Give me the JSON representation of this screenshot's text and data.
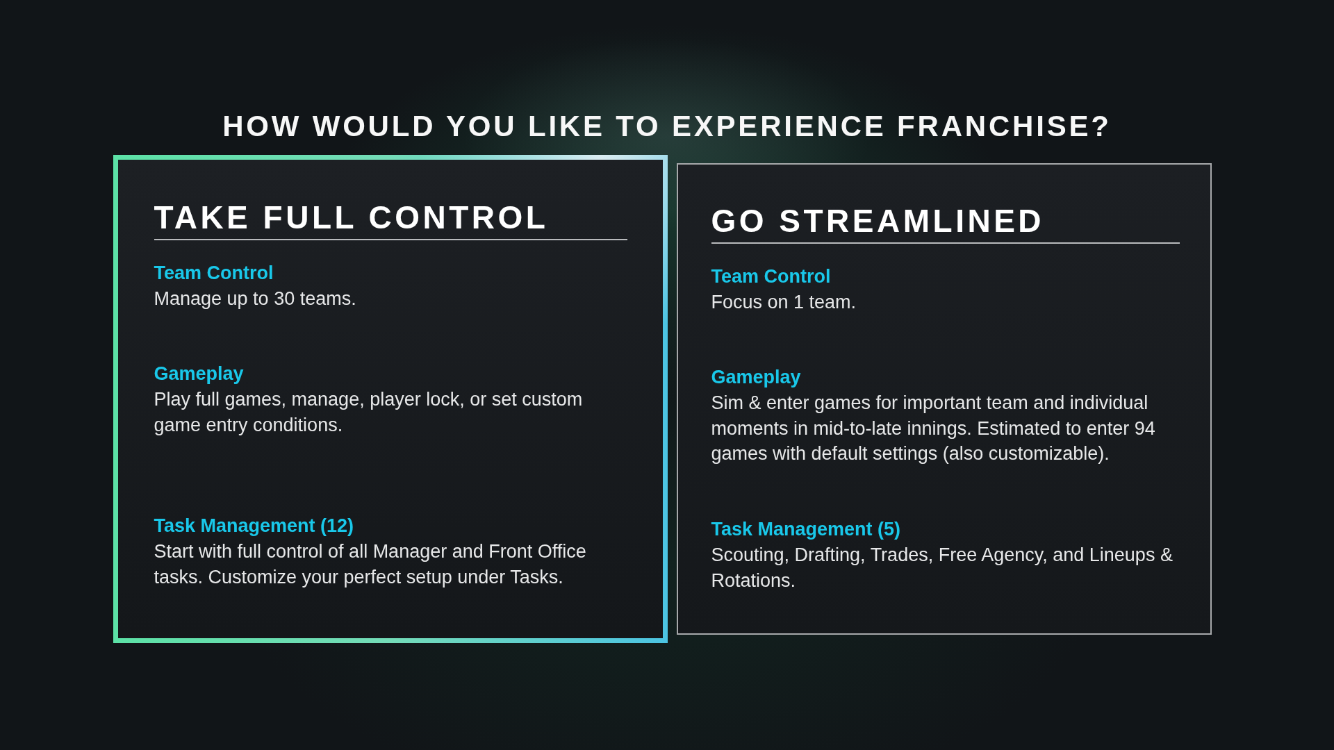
{
  "title": "HOW WOULD YOU LIKE TO EXPERIENCE FRANCHISE?",
  "options": [
    {
      "title": "TAKE FULL CONTROL",
      "selected": true,
      "sections": [
        {
          "label": "Team Control",
          "text": "Manage up to 30 teams."
        },
        {
          "label": "Gameplay",
          "text": "Play full games, manage, player lock, or set custom game entry conditions."
        },
        {
          "label": "Task Management (12)",
          "text": "Start with full control of all Manager and Front Office tasks. Customize your perfect setup under Tasks."
        }
      ]
    },
    {
      "title": "GO STREAMLINED",
      "selected": false,
      "sections": [
        {
          "label": "Team Control",
          "text": "Focus on 1 team."
        },
        {
          "label": "Gameplay",
          "text": "Sim & enter games for important team and individual moments in mid-to-late innings. Estimated to enter 94 games with default settings (also customizable)."
        },
        {
          "label": "Task Management (5)",
          "text": "Scouting, Drafting, Trades, Free Agency, and Lineups & Rotations."
        }
      ]
    }
  ]
}
